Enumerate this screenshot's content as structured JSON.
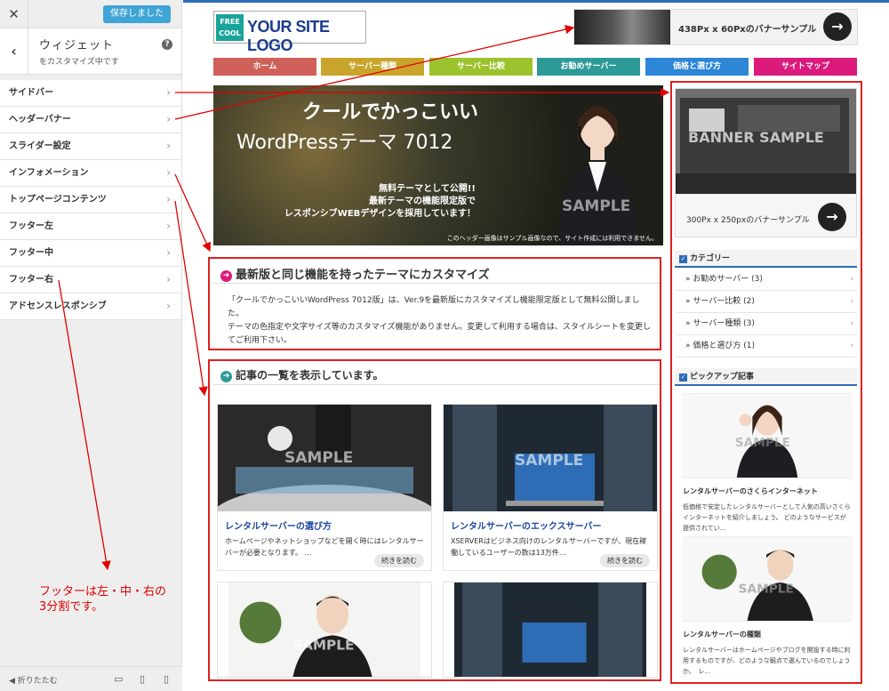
{
  "panel": {
    "saved_button": "保存しました",
    "title": "ウィジェット",
    "subtitle": "をカスタマイズ中です",
    "items": [
      {
        "label": "サイドバー"
      },
      {
        "label": "ヘッダーバナー"
      },
      {
        "label": "スライダー設定"
      },
      {
        "label": "インフォメーション"
      },
      {
        "label": "トップページコンテンツ"
      },
      {
        "label": "フッター左"
      },
      {
        "label": "フッター中"
      },
      {
        "label": "フッター右"
      },
      {
        "label": "アドセンスレスポンシブ"
      }
    ],
    "collapse_label": "折りたたむ"
  },
  "site": {
    "logo_badge_1": "FREE",
    "logo_badge_2": "COOL",
    "logo_text": "YOUR SITE LOGO",
    "header_banner": "438Px x 60Pxのバナーサンプル",
    "nav": [
      {
        "label": "ホーム",
        "color": "#d0605a"
      },
      {
        "label": "サーバー種類",
        "color": "#c8a52a"
      },
      {
        "label": "サーバー比較",
        "color": "#9cc32d"
      },
      {
        "label": "お勧めサーバー",
        "color": "#2e9a98"
      },
      {
        "label": "価格と選び方",
        "color": "#2d86d6"
      },
      {
        "label": "サイトマップ",
        "color": "#dc1a7c"
      }
    ],
    "slider": {
      "headline1": "クールでかっこいい",
      "headline2": "WordPressテーマ 7012",
      "sub1": "無料テーマとして公開!!",
      "sub2": "最新テーマの機能限定版で",
      "sub3": "レスポンシブWEBデザインを採用しています！",
      "watermark": "SAMPLE",
      "note": "このヘッダー画像はサンプル画像なので、サイト作成には利用できません。"
    },
    "intro": {
      "title": "最新版と同じ機能を持ったテーマにカスタマイズ",
      "p1": "「クールでかっこいいWordPress 7012版」は、Ver.9を最新版にカスタマイズし機能限定版として無料公開しました。",
      "p2": "テーマの色指定や文字サイズ等のカスタマイズ機能がありません。変更して利用する場合は、スタイルシートを変更してご利用下さい。"
    },
    "articles": {
      "title": "記事の一覧を表示しています。",
      "items": [
        {
          "title": "レンタルサーバーの選び方",
          "text": "ホームページやネットショップなどを開く時にはレンタルサーバーが必要となります。 …",
          "more": "続きを読む",
          "watermark": "SAMPLE"
        },
        {
          "title": "レンタルサーバーのエックスサーバー",
          "text": "XSERVERはビジネス向けのレンタルサーバーですが、現在稼働しているユーザーの数は13万件…",
          "more": "続きを読む",
          "watermark": "SAMPLE"
        },
        {
          "watermark": "SAMPLE"
        },
        {
          "watermark": ""
        }
      ]
    },
    "sidebar": {
      "banner_watermark": "BANNER SAMPLE",
      "banner_label": "300Px x 250pxのバナーサンプル",
      "category_title": "カテゴリー",
      "categories": [
        {
          "label": "お勧めサーバー (3)"
        },
        {
          "label": "サーバー比較 (2)"
        },
        {
          "label": "サーバー種類 (3)"
        },
        {
          "label": "価格と選び方 (1)"
        }
      ],
      "pickup_title": "ピックアップ記事",
      "pickups": [
        {
          "title": "レンタルサーバーのさくらインターネット",
          "text": "低価格で安定したレンタルサーバーとして人気の高いさくらインターネットを紹介しましょう。 どのようなサービスが提供されてい…",
          "watermark": "SAMPLE"
        },
        {
          "title": "レンタルサーバーの種類",
          "text": "レンタルサーバーはホームページやブログを開設する時に利用するものですが、どのような観点で選んでいるのでしょうか。　レ…",
          "watermark": "SAMPLE"
        }
      ]
    }
  },
  "annotation": {
    "line1": "フッターは左・中・右の",
    "line2": "3分割です。"
  }
}
